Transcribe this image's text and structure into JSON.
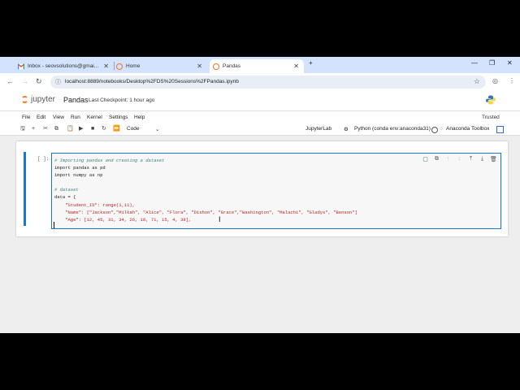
{
  "browser": {
    "tabs": [
      {
        "title": "Inbox - seovsolutions@gmai...",
        "icon": "gmail-icon",
        "active": false
      },
      {
        "title": "Home",
        "icon": "jupyter-tab-icon",
        "active": false
      },
      {
        "title": "Pandas",
        "icon": "jupyter-tab-icon",
        "active": true
      }
    ],
    "new_tab": "+",
    "url": "localhost:8889/notebooks/Desktop%2FDS%20Sessions%2FPandas.ipynb"
  },
  "jupyter": {
    "logo_text": "jupyter",
    "notebook_name": "Pandas",
    "checkpoint": "Last Checkpoint: 1 hour ago",
    "menus": [
      "File",
      "Edit",
      "View",
      "Run",
      "Kernel",
      "Settings",
      "Help"
    ],
    "trusted": "Trusted",
    "cell_type": "Code",
    "jupyterlab_label": "JupyterLab",
    "kernel_label": "Python (conda env:anaconda31)",
    "toolbox_label": "Anaconda Toolbox",
    "prompt": "[ ]:",
    "code_lines": [
      "# Importing pandas and creating a dataset",
      "import pandas as pd",
      "import numpy as np",
      "",
      "# dataset",
      "data = {",
      "    \"Student_ID\": range(1,11),",
      "    \"Name\": [\"Jackson\",\"Milkah\", \"Alice\", \"Flora\", \"Dishon\", \"Grace\",\"Washington\", \"Malachi\", \"Gladys\", \"Benson\"]",
      "    \"Age\": [12, 45, 31, 34, 26, 18, 71, 15, 4, 39],"
    ]
  }
}
